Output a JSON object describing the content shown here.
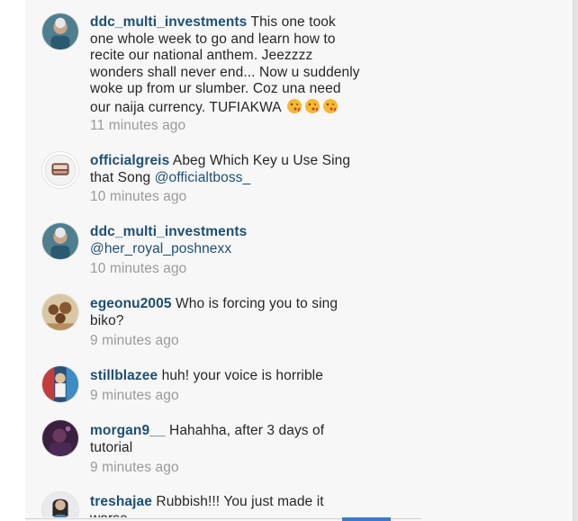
{
  "comments": [
    {
      "username": "ddc_multi_investments",
      "text": "This one took one whole week to go and learn how to recite our national anthem. Jeezzzz wonders shall never end... Now u suddenly woke up from ur slumber. Coz una need our naija currency. TUFIAKWA",
      "emoji": [
        "kissing-face-emoji",
        "kissing-face-emoji",
        "kissing-face-emoji"
      ],
      "time": "11 minutes ago",
      "avatar": "profile-photo"
    },
    {
      "username": "officialgreis",
      "text": "Abeg Which Key u Use Sing that Song",
      "mention": "@officialtboss_",
      "time": "10 minutes ago",
      "avatar": "profile-logo"
    },
    {
      "username": "ddc_multi_investments",
      "text": "",
      "mention": "@her_royal_poshnexx",
      "time": "10 minutes ago",
      "avatar": "profile-photo"
    },
    {
      "username": "egeonu2005",
      "text": "Who is forcing you to sing biko?",
      "time": "9 minutes ago",
      "avatar": "profile-photo"
    },
    {
      "username": "stillblazee",
      "text": "huh! your voice is horrible",
      "time": "9 minutes ago",
      "avatar": "profile-photo"
    },
    {
      "username": "morgan9__",
      "text": "Hahahha, after 3 days of tutorial",
      "time": "9 minutes ago",
      "avatar": "profile-photo"
    },
    {
      "username": "treshajae",
      "text": "Rubbish!!! You just made it worse",
      "time": "",
      "avatar": "profile-photo"
    }
  ],
  "colors": {
    "username": "#1d4f73",
    "body_text": "#262626",
    "timestamp": "#9a9a9a",
    "background": "#f7f7f7",
    "accent": "#3b7ac9"
  }
}
